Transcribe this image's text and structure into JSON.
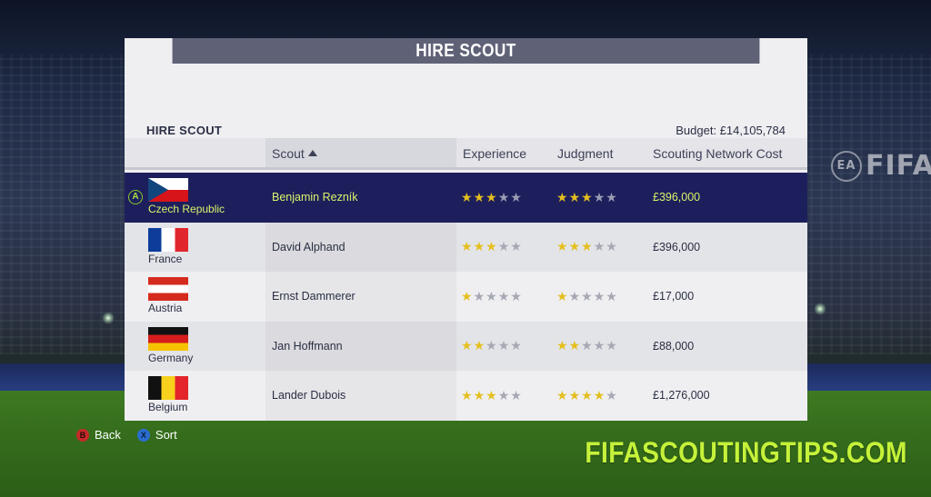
{
  "window": {
    "title": "HIRE SCOUT"
  },
  "section": {
    "label": "HIRE SCOUT",
    "budget": "Budget: £14,105,784"
  },
  "columns": {
    "scout": "Scout",
    "experience": "Experience",
    "judgment": "Judgment",
    "cost": "Scouting Network Cost"
  },
  "sort": {
    "column": "Scout",
    "direction": "ascending"
  },
  "select_button": "A",
  "scouts": [
    {
      "country": "Czech Republic",
      "flag": "flag-cz",
      "name": "Benjamin Rezník",
      "experience": 3,
      "judgment": 3,
      "cost": "£396,000",
      "selected": true
    },
    {
      "country": "France",
      "flag": "flag-fr",
      "name": "David Alphand",
      "experience": 3,
      "judgment": 3,
      "cost": "£396,000",
      "selected": false
    },
    {
      "country": "Austria",
      "flag": "flag-at",
      "name": "Ernst Dammerer",
      "experience": 1,
      "judgment": 1,
      "cost": "£17,000",
      "selected": false
    },
    {
      "country": "Germany",
      "flag": "flag-de",
      "name": "Jan Hoffmann",
      "experience": 2,
      "judgment": 2,
      "cost": "£88,000",
      "selected": false
    },
    {
      "country": "Belgium",
      "flag": "flag-be",
      "name": "Lander Dubois",
      "experience": 3,
      "judgment": 4,
      "cost": "£1,276,000",
      "selected": false
    }
  ],
  "max_stars": 5,
  "controls": {
    "back": {
      "button": "B",
      "label": "Back"
    },
    "sort": {
      "button": "X",
      "label": "Sort"
    }
  },
  "branding": {
    "fifa": "FIFA",
    "ea": "EA"
  },
  "watermark": "FIFASCOUTINGTIPS.COM",
  "colors": {
    "selected_row": "#1d1f5c",
    "selected_text": "#d9f36a",
    "star": "#e4bf1e",
    "header": "#5f6277"
  }
}
